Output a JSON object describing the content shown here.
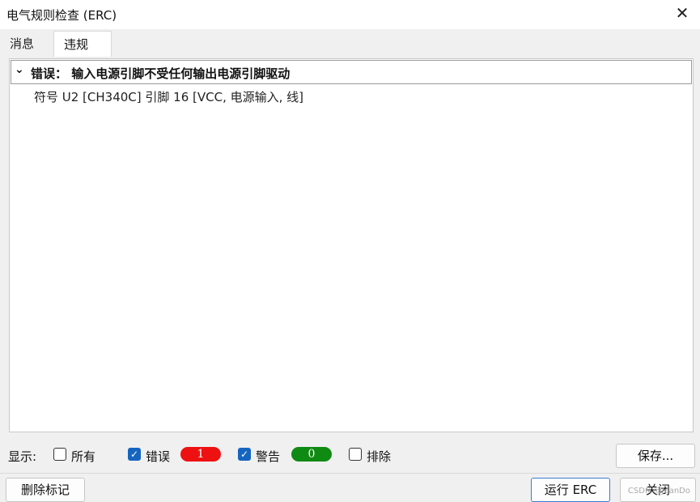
{
  "window": {
    "title": "电气规则检查 (ERC)",
    "close_glyph": "✕"
  },
  "tabs": [
    {
      "label": "消息"
    },
    {
      "label": "违规"
    }
  ],
  "violation": {
    "chevron": "⌄",
    "header": "错误：   输入电源引脚不受任何输出电源引脚驱动",
    "detail": "符号 U2 [CH340C] 引脚 16 [VCC, 电源输入, 线]"
  },
  "filter": {
    "label": "显示:",
    "all": {
      "label": "所有",
      "checked": false
    },
    "errors": {
      "label": "错误",
      "checked": true,
      "count": "1",
      "color": "#ee1111"
    },
    "warnings": {
      "label": "警告",
      "checked": true,
      "count": "0",
      "color": "#0f8a12"
    },
    "exclusions": {
      "label": "排除",
      "checked": false
    },
    "save_button": "保存..."
  },
  "footer": {
    "delete_markers": "删除标记",
    "run_erc": "运行 ERC",
    "close": "关闭",
    "watermark": "CSDN @JeanDo"
  }
}
